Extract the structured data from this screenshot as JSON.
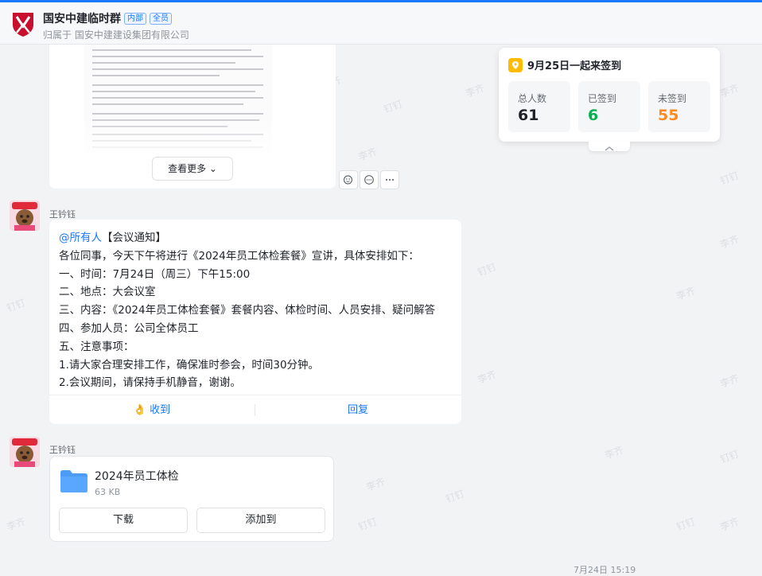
{
  "header": {
    "title": "国安中建临时群",
    "badge_internal": "内部",
    "badge_all": "全员",
    "subtitle": "归属于 国安中建建设集团有限公司"
  },
  "watermarks": [
    "李齐",
    "钉钉"
  ],
  "doc_preview": {
    "view_more_label": "查看更多 ⌄"
  },
  "checkin": {
    "title": "9月25日一起来签到",
    "stats": [
      {
        "label": "总人数",
        "value": "61",
        "color": "#1f2329"
      },
      {
        "label": "已签到",
        "value": "6",
        "color": "#00b14f"
      },
      {
        "label": "未签到",
        "value": "55",
        "color": "#ff8a1f"
      }
    ]
  },
  "messages": [
    {
      "sender": "王钤钰",
      "mention": "@所有人",
      "lines": [
        "【会议通知】",
        "各位同事，今天下午将进行《2024年员工体检套餐》宣讲，具体安排如下：",
        "一、时间：7月24日（周三）下午15:00",
        "二、地点：大会议室",
        "三、内容：《2024年员工体检套餐》套餐内容、体检时间、人员安排、疑问解答",
        "四、参加人员：公司全体员工",
        "五、注意事项：",
        "1.请大家合理安排工作，确保准时参会，时间30分钟。",
        "2.会议期间，请保持手机静音，谢谢。"
      ],
      "receive_label": "👌 收到",
      "reply_label": "回复"
    },
    {
      "sender": "王钤钰",
      "file_name": "2024年员工体检",
      "file_size": "63 KB",
      "download_label": "下载",
      "add_to_label": "添加到"
    }
  ],
  "timestamp": "7月24日 15:19",
  "colors": {
    "accent": "#1677ff",
    "signed": "#00b14f",
    "unsigned": "#ff8a1f"
  }
}
